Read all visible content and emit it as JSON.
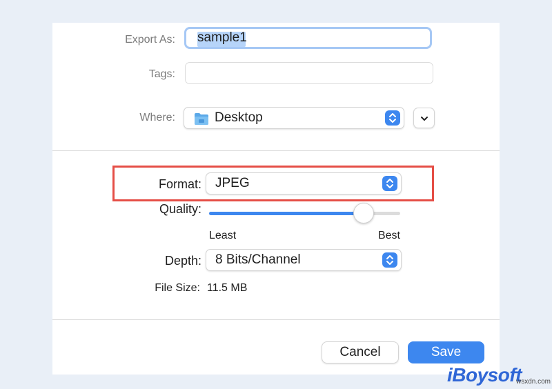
{
  "dialog": {
    "export_as": {
      "label": "Export As:",
      "value": "sample1"
    },
    "tags": {
      "label": "Tags:",
      "value": ""
    },
    "where": {
      "label": "Where:",
      "value": "Desktop"
    },
    "format": {
      "label": "Format:",
      "value": "JPEG"
    },
    "quality": {
      "label": "Quality:",
      "min_label": "Least",
      "max_label": "Best",
      "value_percent": 81
    },
    "depth": {
      "label": "Depth:",
      "value": "8 Bits/Channel"
    },
    "file_size": {
      "label": "File Size:",
      "value": "11.5 MB"
    },
    "buttons": {
      "cancel": "Cancel",
      "save": "Save"
    }
  },
  "watermark": {
    "brand": "iBoysoft",
    "site": "wsxdn.com"
  },
  "icons": {
    "folder": "folder-icon",
    "stepper": "up-down-stepper-icon",
    "expand": "chevron-down-icon"
  },
  "colors": {
    "accent": "#3d87ef",
    "highlight": "#e54e46",
    "focus_ring": "#a6c8f5",
    "watermark": "#2f66d6"
  }
}
